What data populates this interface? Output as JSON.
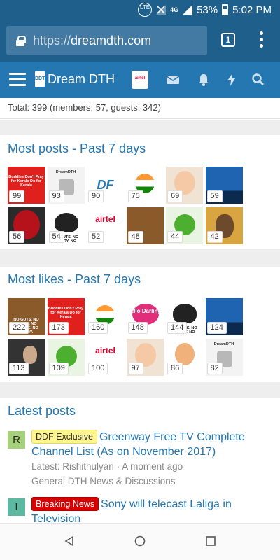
{
  "status_bar": {
    "network_badge": "LTE",
    "network_type": "4G",
    "battery": "53%",
    "time": "5:02 PM"
  },
  "browser": {
    "url_scheme": "https://",
    "url_host": "dreamdth.com",
    "tab_count": "1"
  },
  "site_nav": {
    "logo_mark": "DDT",
    "site_name": "Dream DTH",
    "icons": [
      "menu-icon",
      "envelope-icon",
      "bell-icon",
      "bolt-icon",
      "search-icon"
    ]
  },
  "online_stats": {
    "text": "Total: 399 (members: 57, guests: 342)"
  },
  "most_posts": {
    "title": "Most posts - Past 7 days",
    "members": [
      {
        "count": "99",
        "avatar": "red-kerala-banner",
        "mini": "Buddies Don't Pray for Kerala Do for Kerala"
      },
      {
        "count": "93",
        "avatar": "dreamdth-lnb",
        "mini": "DreamDTH"
      },
      {
        "count": "90",
        "avatar": "df-logo",
        "mini": "DF"
      },
      {
        "count": "75",
        "avatar": "india-emblem",
        "mini": ""
      },
      {
        "count": "69",
        "avatar": "boss-baby",
        "mini": ""
      },
      {
        "count": "59",
        "avatar": "bridge-night",
        "mini": ""
      },
      {
        "count": "56",
        "avatar": "deadpool",
        "mini": ""
      },
      {
        "count": "54",
        "avatar": "bull-skull",
        "mini": "NO GUTS. NO GLORY. NO MUSCLE. NO STORY."
      },
      {
        "count": "52",
        "avatar": "airtel-digital-tv",
        "mini": "airtel"
      },
      {
        "count": "48",
        "avatar": "lion",
        "mini": ""
      },
      {
        "count": "44",
        "avatar": "green-apple",
        "mini": ""
      },
      {
        "count": "42",
        "avatar": "portrait-hat",
        "mini": ""
      }
    ]
  },
  "most_likes": {
    "title": "Most likes - Past 7 days",
    "members": [
      {
        "count": "222",
        "avatar": "lion",
        "mini": "NO GUTS. NO GLORY. NO MUSCLE. NO STORY."
      },
      {
        "count": "173",
        "avatar": "red-kerala-banner",
        "mini": "Buddies Don't Pray for Kerala Do for Kerala"
      },
      {
        "count": "160",
        "avatar": "india-emblem",
        "mini": ""
      },
      {
        "count": "148",
        "avatar": "hello-darling",
        "mini": "Hello Darling!"
      },
      {
        "count": "144",
        "avatar": "bull-skull",
        "mini": "NO GUTS. NO GLORY. NO MUSCLE. NO STORY."
      },
      {
        "count": "124",
        "avatar": "bridge-night",
        "mini": ""
      },
      {
        "count": "113",
        "avatar": "man-suit",
        "mini": ""
      },
      {
        "count": "109",
        "avatar": "green-apple",
        "mini": ""
      },
      {
        "count": "100",
        "avatar": "airtel-digital-tv",
        "mini": "airtel"
      },
      {
        "count": "97",
        "avatar": "boss-baby",
        "mini": ""
      },
      {
        "count": "86",
        "avatar": "cartoon-boy",
        "mini": ""
      },
      {
        "count": "82",
        "avatar": "dreamdth-lnb",
        "mini": "DreamDTH"
      }
    ]
  },
  "latest_posts": {
    "title": "Latest posts",
    "posts": [
      {
        "avatar_letter": "R",
        "avatar_color": "#a5d17b",
        "label": "DDF Exclusive",
        "title": "Greenway Free TV Complete Channel List (As on November 2017)",
        "latest": "Latest: Rishithulyan · A moment ago",
        "forum": "General DTH News & Discussions"
      },
      {
        "avatar_letter": "I",
        "avatar_color": "#5cb8a0",
        "label": "Breaking News",
        "title": "Sony will telecast Laliga in Television"
      }
    ]
  },
  "colors": {
    "status_bar": "#1f5f8b",
    "site_nav": "#2577b1",
    "link": "#2577b1"
  }
}
